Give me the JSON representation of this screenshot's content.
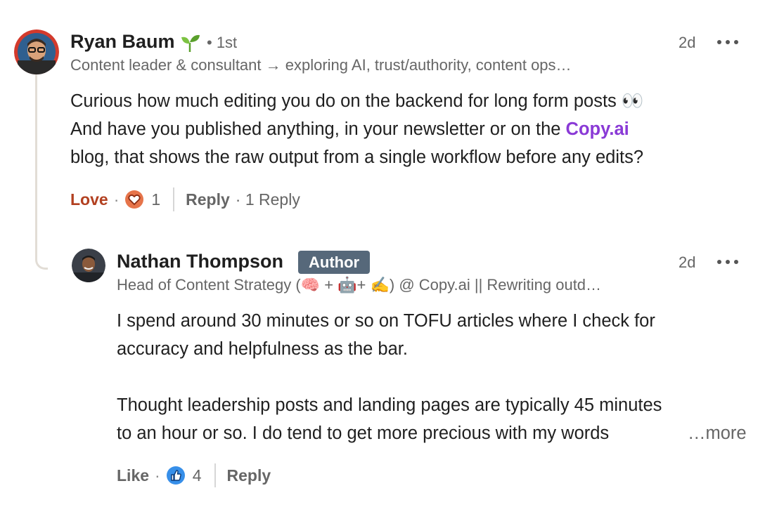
{
  "comment": {
    "author_name": "Ryan Baum",
    "degree": "• 1st",
    "headline": "Content leader & consultant → exploring AI, trust/authority, content ops…",
    "time": "2d",
    "body_line1": "Curious how much editing you do on the backend for long form posts 👀",
    "body_line2_prefix": "And have you published anything, in your newsletter or on the ",
    "body_link": "Copy.ai",
    "body_line3": " blog, that shows the raw output from a single workflow before any edits?",
    "actions": {
      "reaction_label": "Love",
      "reaction_icon": "heart-reaction-icon",
      "reaction_count": "1",
      "reply_label": "Reply",
      "reply_count_text": "· 1 Reply"
    }
  },
  "reply": {
    "author_name": "Nathan Thompson",
    "badge": "Author",
    "headline": "Head of Content Strategy (🧠 + 🤖+ ✍️) @ Copy.ai || Rewriting outd…",
    "time": "2d",
    "body_line1": "I spend around 30 minutes or so on TOFU articles where I check for",
    "body_line2": "accuracy and helpfulness as the bar.",
    "body_line3": "Thought leadership posts and landing pages are typically 45 minutes",
    "body_line4": "to an hour or so. I do tend to get more precious with my words",
    "more_label": "…more",
    "actions": {
      "reaction_label": "Like",
      "reaction_icon": "thumbs-up-reaction-icon",
      "reaction_count": "4",
      "reply_label": "Reply"
    }
  },
  "colors": {
    "love": "#b24020",
    "link": "#8a3ad6",
    "badge_bg": "#56687a",
    "like_blue": "#378fe9"
  }
}
